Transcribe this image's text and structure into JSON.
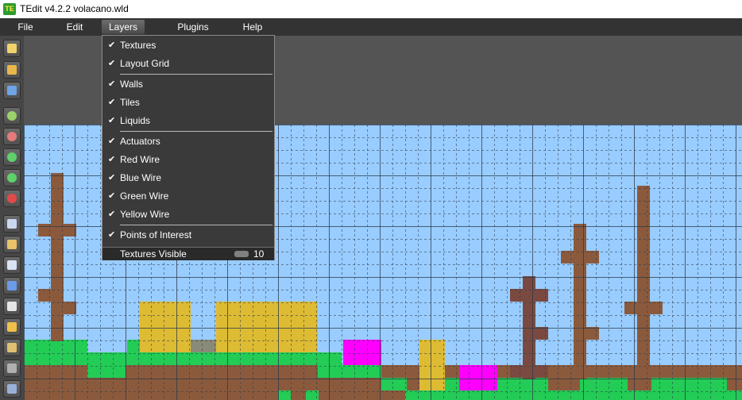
{
  "window": {
    "title": "TEdit v4.2.2 volacano.wld",
    "icon_text": "TE"
  },
  "menubar": {
    "items": [
      "File",
      "Edit",
      "Layers",
      "Plugins",
      "Help"
    ],
    "active": "Layers"
  },
  "layers_menu": {
    "items": [
      {
        "label": "Textures",
        "checked": true
      },
      {
        "label": "Layout Grid",
        "checked": true
      },
      {
        "label": "Walls",
        "checked": true
      },
      {
        "label": "Tiles",
        "checked": true
      },
      {
        "label": "Liquids",
        "checked": true
      },
      {
        "label": "Actuators",
        "checked": true
      },
      {
        "label": "Red Wire",
        "checked": true
      },
      {
        "label": "Blue Wire",
        "checked": true
      },
      {
        "label": "Green Wire",
        "checked": true
      },
      {
        "label": "Yellow Wire",
        "checked": true
      },
      {
        "label": "Points of Interest",
        "checked": true
      }
    ],
    "textures_visible": {
      "label": "Textures Visible",
      "value": "10"
    }
  },
  "toolbar": {
    "tools": [
      {
        "name": "new-world-icon",
        "color": "#f2d36b"
      },
      {
        "name": "open-world-icon",
        "color": "#e8b84a"
      },
      {
        "name": "save-world-icon",
        "color": "#6fa4e6"
      },
      {
        "name": "zoom-in-icon",
        "color": "#9bd36a"
      },
      {
        "name": "zoom-out-icon",
        "color": "#e57a7a"
      },
      {
        "name": "redo-icon",
        "color": "#5fd06a"
      },
      {
        "name": "undo-icon",
        "color": "#5fd06a"
      },
      {
        "name": "stop-icon",
        "color": "#e24a4a"
      },
      {
        "name": "copy-icon",
        "color": "#c9d8f0"
      },
      {
        "name": "paste-icon",
        "color": "#e8c36a"
      },
      {
        "name": "arrow-select-icon",
        "color": "#d8e4f4"
      },
      {
        "name": "rectangle-select-icon",
        "color": "#6a9be8"
      },
      {
        "name": "picker-icon",
        "color": "#e6e6e6"
      },
      {
        "name": "pencil-icon",
        "color": "#f0c04a"
      },
      {
        "name": "brush-icon",
        "color": "#e0c070"
      },
      {
        "name": "hammer-icon",
        "color": "#b0b0b0"
      },
      {
        "name": "fill-icon",
        "color": "#9ab0d8"
      }
    ]
  },
  "colors": {
    "menubar": "#333333",
    "sky": "#99ccff",
    "grass": "#22cc55",
    "dirt": "#8b5a3c",
    "wood": "#8b5a3c",
    "gold_wall": "#ddbb33",
    "magenta": "#ff00ff",
    "stone": "#8a8a78",
    "dark_wood": "#7a4a40"
  }
}
